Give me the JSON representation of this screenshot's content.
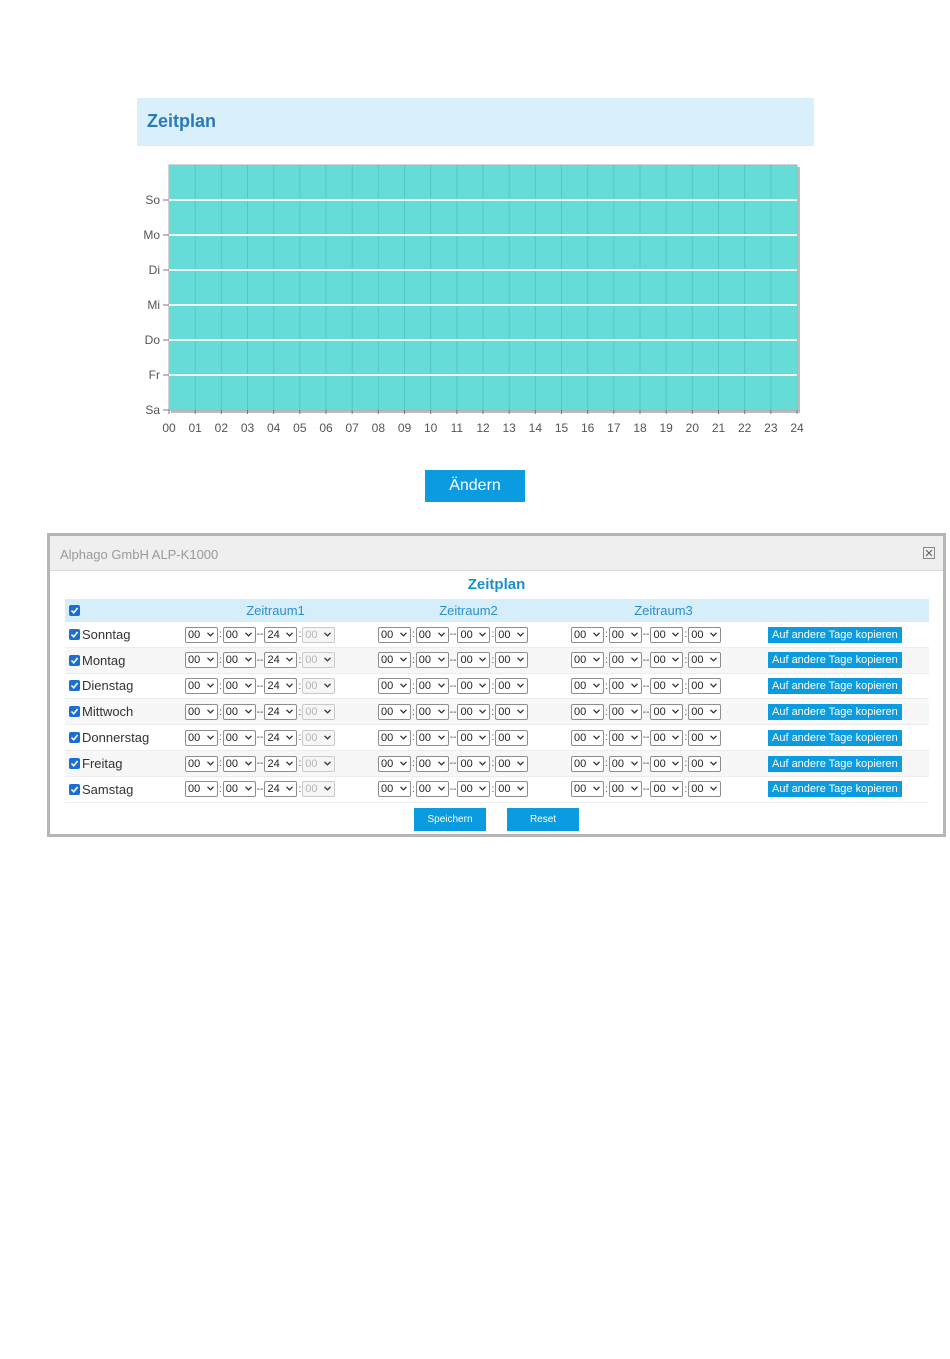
{
  "header": {
    "title": "Zeitplan"
  },
  "chart_data": {
    "type": "heatmap",
    "title": "",
    "days": [
      "So",
      "Mo",
      "Di",
      "Mi",
      "Do",
      "Fr",
      "Sa"
    ],
    "hours": [
      "00",
      "01",
      "02",
      "03",
      "04",
      "05",
      "06",
      "07",
      "08",
      "09",
      "10",
      "11",
      "12",
      "13",
      "14",
      "15",
      "16",
      "17",
      "18",
      "19",
      "20",
      "21",
      "22",
      "23",
      "24"
    ],
    "xlim": [
      0,
      24
    ],
    "series": [
      {
        "day": "So",
        "start": 0,
        "end": 24
      },
      {
        "day": "Mo",
        "start": 0,
        "end": 24
      },
      {
        "day": "Di",
        "start": 0,
        "end": 24
      },
      {
        "day": "Mi",
        "start": 0,
        "end": 24
      },
      {
        "day": "Do",
        "start": 0,
        "end": 24
      },
      {
        "day": "Fr",
        "start": 0,
        "end": 24
      },
      {
        "day": "Sa",
        "start": 0,
        "end": 24
      }
    ],
    "fill_color": "#66dcd8",
    "grid": true
  },
  "change_button": "Ändern",
  "dialog": {
    "title": "Alphago GmbH ALP-K1000",
    "heading": "Zeitplan",
    "columns": [
      "Zeitraum1",
      "Zeitraum2",
      "Zeitraum3"
    ],
    "copy_label": "Auf andere Tage kopieren",
    "save_label": "Speichern",
    "reset_label": "Reset",
    "separator_colon": ":",
    "separator_dash": "--",
    "rows": [
      {
        "day": "Sonntag",
        "checked": true,
        "p1": [
          "00",
          "00",
          "24",
          "00"
        ],
        "p2": [
          "00",
          "00",
          "00",
          "00"
        ],
        "p3": [
          "00",
          "00",
          "00",
          "00"
        ]
      },
      {
        "day": "Montag",
        "checked": true,
        "p1": [
          "00",
          "00",
          "24",
          "00"
        ],
        "p2": [
          "00",
          "00",
          "00",
          "00"
        ],
        "p3": [
          "00",
          "00",
          "00",
          "00"
        ]
      },
      {
        "day": "Dienstag",
        "checked": true,
        "p1": [
          "00",
          "00",
          "24",
          "00"
        ],
        "p2": [
          "00",
          "00",
          "00",
          "00"
        ],
        "p3": [
          "00",
          "00",
          "00",
          "00"
        ]
      },
      {
        "day": "Mittwoch",
        "checked": true,
        "p1": [
          "00",
          "00",
          "24",
          "00"
        ],
        "p2": [
          "00",
          "00",
          "00",
          "00"
        ],
        "p3": [
          "00",
          "00",
          "00",
          "00"
        ]
      },
      {
        "day": "Donnerstag",
        "checked": true,
        "p1": [
          "00",
          "00",
          "24",
          "00"
        ],
        "p2": [
          "00",
          "00",
          "00",
          "00"
        ],
        "p3": [
          "00",
          "00",
          "00",
          "00"
        ]
      },
      {
        "day": "Freitag",
        "checked": true,
        "p1": [
          "00",
          "00",
          "24",
          "00"
        ],
        "p2": [
          "00",
          "00",
          "00",
          "00"
        ],
        "p3": [
          "00",
          "00",
          "00",
          "00"
        ]
      },
      {
        "day": "Samstag",
        "checked": true,
        "p1": [
          "00",
          "00",
          "24",
          "00"
        ],
        "p2": [
          "00",
          "00",
          "00",
          "00"
        ],
        "p3": [
          "00",
          "00",
          "00",
          "00"
        ]
      }
    ]
  },
  "colors": {
    "accent": "#0b9be0",
    "header_bg": "#d9effa",
    "chart_fill": "#66dcd8",
    "checkbox": "#1b6fd4"
  },
  "icons": {
    "close": "close-icon",
    "checkbox": "checkbox-icon",
    "dropdown": "chevron-down-icon"
  }
}
